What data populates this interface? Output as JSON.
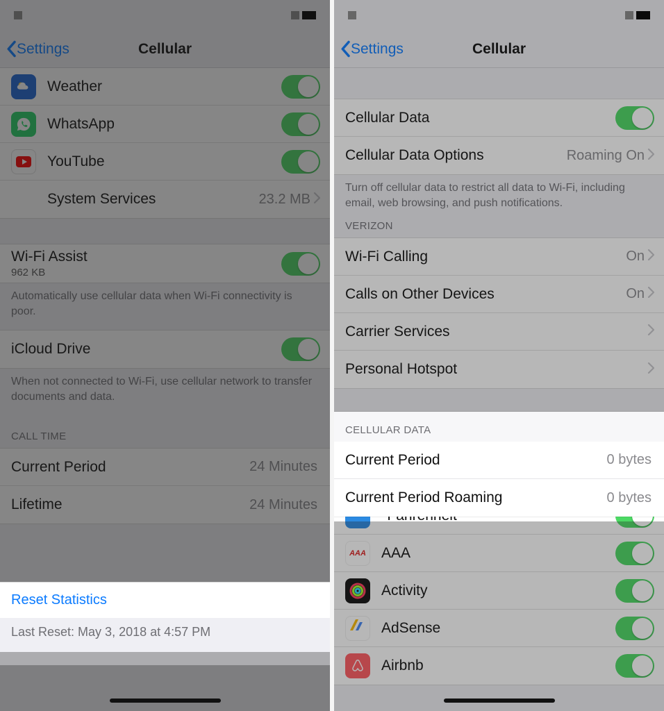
{
  "left": {
    "back": "Settings",
    "title": "Cellular",
    "apps": [
      {
        "name": "Weather",
        "icon": "weather-icon"
      },
      {
        "name": "WhatsApp",
        "icon": "whatsapp-icon"
      },
      {
        "name": "YouTube",
        "icon": "youtube-icon"
      }
    ],
    "system_services": {
      "label": "System Services",
      "value": "23.2 MB"
    },
    "wifi_assist": {
      "label": "Wi-Fi Assist",
      "sub": "962 KB"
    },
    "wifi_assist_footer": "Automatically use cellular data when Wi-Fi connectivity is poor.",
    "icloud": {
      "label": "iCloud Drive"
    },
    "icloud_footer": "When not connected to Wi-Fi, use cellular network to transfer documents and data.",
    "call_time_header": "CALL TIME",
    "call_time": [
      {
        "label": "Current Period",
        "value": "24 Minutes"
      },
      {
        "label": "Lifetime",
        "value": "24 Minutes"
      }
    ],
    "reset": "Reset Statistics",
    "last_reset": "Last Reset: May 3, 2018 at 4:57 PM"
  },
  "right": {
    "back": "Settings",
    "title": "Cellular",
    "cellular_data_label": "Cellular Data",
    "cellular_options": {
      "label": "Cellular Data Options",
      "value": "Roaming On"
    },
    "cellular_footer": "Turn off cellular data to restrict all data to Wi-Fi, including email, web browsing, and push notifications.",
    "carrier_header": "VERIZON",
    "carrier_rows": [
      {
        "label": "Wi-Fi Calling",
        "value": "On"
      },
      {
        "label": "Calls on Other Devices",
        "value": "On"
      },
      {
        "label": "Carrier Services",
        "value": ""
      },
      {
        "label": "Personal Hotspot",
        "value": ""
      }
    ],
    "data_header": "CELLULAR DATA",
    "data_rows": [
      {
        "label": "Current Period",
        "value": "0 bytes"
      },
      {
        "label": "Current Period Roaming",
        "value": "0 bytes"
      }
    ],
    "data_apps": [
      {
        "name": "°Fahrenheit",
        "icon": "fahrenheit-icon"
      },
      {
        "name": "AAA",
        "icon": "aaa-icon"
      },
      {
        "name": "Activity",
        "icon": "activity-icon"
      },
      {
        "name": "AdSense",
        "icon": "adsense-icon"
      },
      {
        "name": "Airbnb",
        "icon": "airbnb-icon"
      }
    ]
  }
}
